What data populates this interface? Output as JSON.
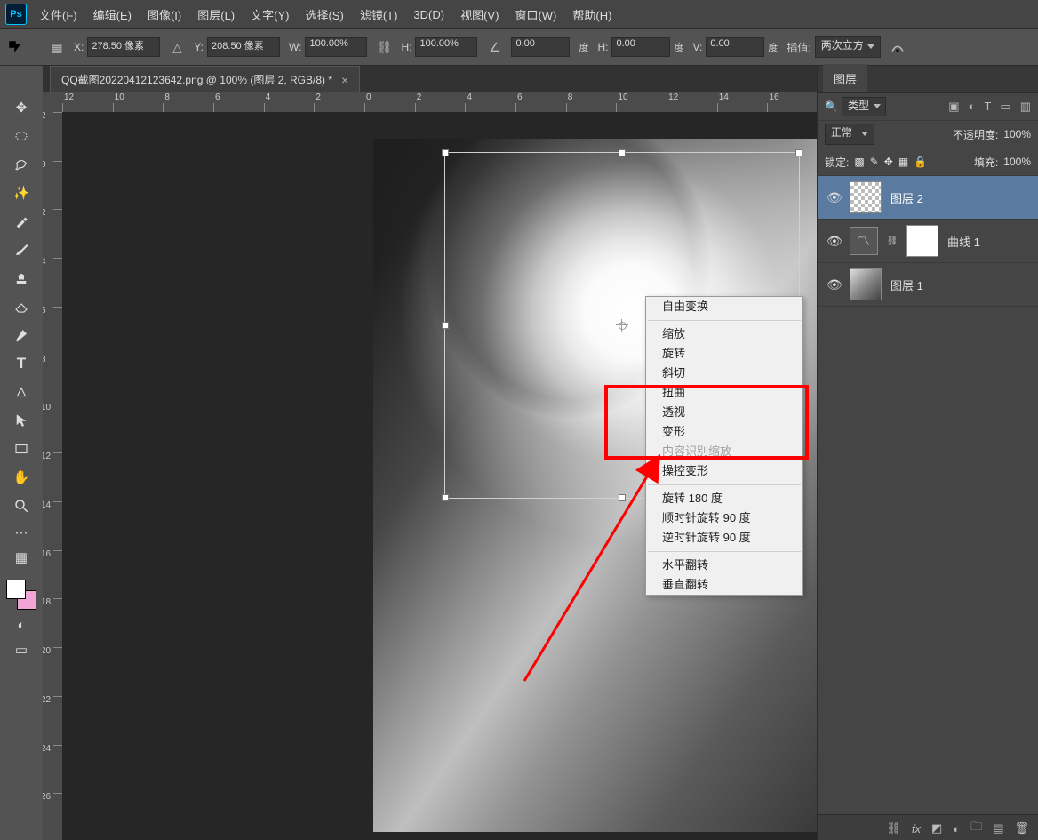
{
  "app": {
    "logo": "Ps"
  },
  "menubar": {
    "items": [
      "文件(F)",
      "编辑(E)",
      "图像(I)",
      "图层(L)",
      "文字(Y)",
      "选择(S)",
      "滤镜(T)",
      "3D(D)",
      "视图(V)",
      "窗口(W)",
      "帮助(H)"
    ]
  },
  "optionbar": {
    "x_label": "X:",
    "x_val": "278.50 像素",
    "y_label": "Y:",
    "y_val": "208.50 像素",
    "w_label": "W:",
    "w_val": "100.00%",
    "h_label": "H:",
    "h_val": "100.00%",
    "angle_val": "0.00",
    "angle_unit": "度",
    "hskew_label": "H:",
    "hskew_val": "0.00",
    "hskew_unit": "度",
    "vskew_label": "V:",
    "vskew_val": "0.00",
    "vskew_unit": "度",
    "interp_label": "插值:",
    "interp_val": "两次立方"
  },
  "document": {
    "tab_title": "QQ截图20220412123642.png @ 100% (图层 2, RGB/8) *"
  },
  "ruler": {
    "h_ticks": [
      "12",
      "10",
      "8",
      "6",
      "4",
      "2",
      "0",
      "2",
      "4",
      "6",
      "8",
      "10",
      "12",
      "14",
      "16"
    ],
    "v_ticks": [
      "2",
      "0",
      "2",
      "4",
      "6",
      "8",
      "10",
      "12",
      "14",
      "16",
      "18",
      "20",
      "22",
      "24",
      "26"
    ]
  },
  "context_menu": {
    "free": "自由变换",
    "scale": "缩放",
    "rotate": "旋转",
    "skew": "斜切",
    "distort": "扭曲",
    "perspective": "透视",
    "warp": "变形",
    "content_aware": "内容识别缩放",
    "puppet": "操控变形",
    "rot180": "旋转 180 度",
    "rotcw": "顺时针旋转 90 度",
    "rotccw": "逆时针旋转 90 度",
    "fliph": "水平翻转",
    "flipv": "垂直翻转"
  },
  "layers_panel": {
    "tab": "图层",
    "search_type": "类型",
    "blend_mode": "正常",
    "opacity_label": "不透明度:",
    "opacity_val": "100%",
    "lock_label": "锁定:",
    "fill_label": "填充:",
    "fill_val": "100%",
    "layers": [
      {
        "name": "图层 2"
      },
      {
        "name": "曲线 1"
      },
      {
        "name": "图层 1"
      }
    ]
  }
}
